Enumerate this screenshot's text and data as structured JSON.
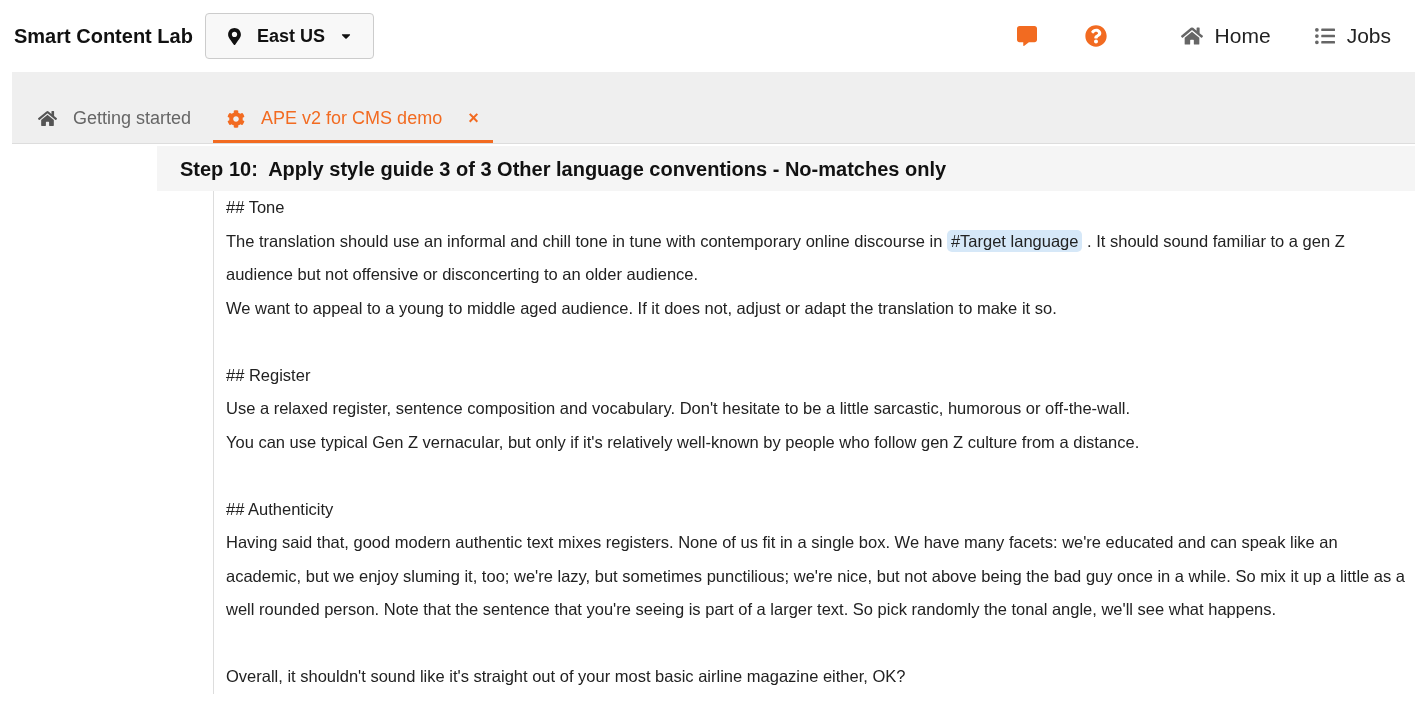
{
  "app": {
    "title": "Smart Content Lab",
    "region": "East US"
  },
  "nav": [
    {
      "kind": "home",
      "label": "Home"
    },
    {
      "kind": "jobs",
      "label": "Jobs"
    }
  ],
  "tabs": [
    {
      "kind": "home",
      "label": "Getting started",
      "selected": false
    },
    {
      "kind": "gear",
      "label": "APE v2 for CMS demo",
      "selected": true,
      "close": "×"
    }
  ],
  "step": {
    "title": "Step 10:  Apply style guide 3 of 3 Other language conventions - No-matches only"
  },
  "lines": [
    {
      "kind": "text",
      "parts": [
        {
          "text": "## Tone"
        }
      ]
    },
    {
      "kind": "text",
      "parts": [
        {
          "text": "The translation should use an informal and chill tone in tune with contemporary online discourse in "
        },
        {
          "kind": "tag",
          "text": "#Target language"
        },
        {
          "text": " . It should sound familiar to a gen Z audience but not offensive or disconcerting to an older audience."
        }
      ]
    },
    {
      "kind": "text",
      "parts": [
        {
          "text": "We want to appeal to a young to middle aged audience. If it does not, adjust or adapt the translation to make it so."
        }
      ]
    },
    {
      "kind": "blank"
    },
    {
      "kind": "text",
      "parts": [
        {
          "text": "## Register"
        }
      ]
    },
    {
      "kind": "text",
      "parts": [
        {
          "text": "Use a relaxed register, sentence composition and vocabulary. Don't hesitate to be a little sarcastic, humorous or off-the-wall."
        }
      ]
    },
    {
      "kind": "text",
      "parts": [
        {
          "text": "You can use typical Gen Z vernacular, but only if it's relatively well-known by people who follow gen Z culture from a distance."
        }
      ]
    },
    {
      "kind": "blank"
    },
    {
      "kind": "text",
      "parts": [
        {
          "text": "## Authenticity"
        }
      ]
    },
    {
      "kind": "text",
      "parts": [
        {
          "text": "Having said that, good modern authentic text mixes registers. None of us fit in a single box. We have many facets: we're educated and can speak like an academic, but we enjoy sluming it, too; we're lazy, but sometimes punctilious; we're nice, but not above being the bad guy once in a while. So mix it up a little as a well rounded person. Note that the sentence that you're seeing is part of a larger text. So pick randomly the tonal angle, we'll see what happens."
        }
      ]
    },
    {
      "kind": "blank"
    },
    {
      "kind": "text",
      "parts": [
        {
          "text": "Overall, it shouldn't sound like it's straight out of your most basic airline magazine either, OK?"
        }
      ]
    }
  ]
}
